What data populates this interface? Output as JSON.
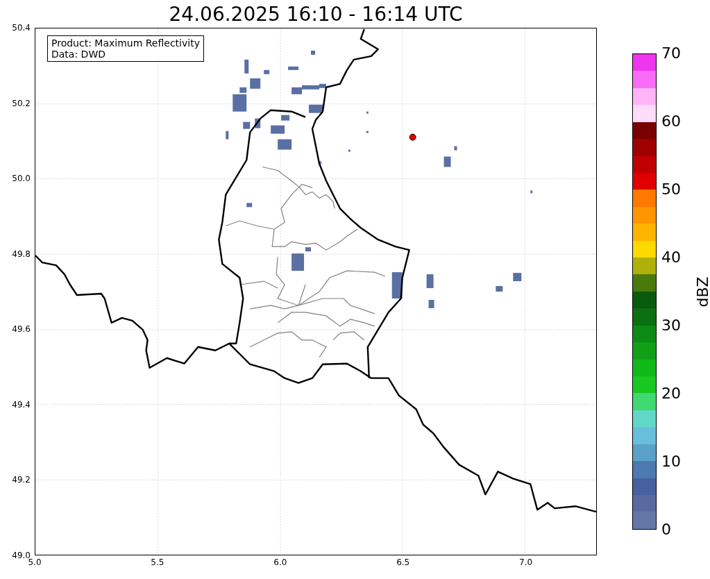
{
  "title": "24.06.2025 16:10 - 16:14 UTC",
  "info_box": {
    "lines": [
      "Product: Maximum Reflectivity",
      "Data: DWD"
    ]
  },
  "axes": {
    "x_ticks": [
      "5.0",
      "5.5",
      "6.0",
      "6.5",
      "7.0"
    ],
    "y_ticks": [
      "50.4",
      "50.2",
      "50.0",
      "49.8",
      "49.6",
      "49.4",
      "49.2",
      "49.0"
    ]
  },
  "colorbar": {
    "label": "dBZ",
    "ticks": [
      "70",
      "60",
      "50",
      "40",
      "30",
      "20",
      "10",
      "0"
    ],
    "bins": [
      {
        "color": "#6478a8"
      },
      {
        "color": "#5a6aa0"
      },
      {
        "color": "#4760a0"
      },
      {
        "color": "#4b7ab0"
      },
      {
        "color": "#5aa0c8"
      },
      {
        "color": "#66c0dc"
      },
      {
        "color": "#62d8c8"
      },
      {
        "color": "#40d870"
      },
      {
        "color": "#18c820"
      },
      {
        "color": "#10b818"
      },
      {
        "color": "#10a018"
      },
      {
        "color": "#0c8a14"
      },
      {
        "color": "#0a7010"
      },
      {
        "color": "#085a0c"
      },
      {
        "color": "#4a7a0c"
      },
      {
        "color": "#b0b00a"
      },
      {
        "color": "#ffd800"
      },
      {
        "color": "#ffb400"
      },
      {
        "color": "#ff9600"
      },
      {
        "color": "#ff7800"
      },
      {
        "color": "#e00000"
      },
      {
        "color": "#c00000"
      },
      {
        "color": "#a00000"
      },
      {
        "color": "#780000"
      },
      {
        "color": "#ffdcfa"
      },
      {
        "color": "#ffb4f8"
      },
      {
        "color": "#fa6cf8"
      },
      {
        "color": "#ee36ee"
      }
    ]
  }
}
